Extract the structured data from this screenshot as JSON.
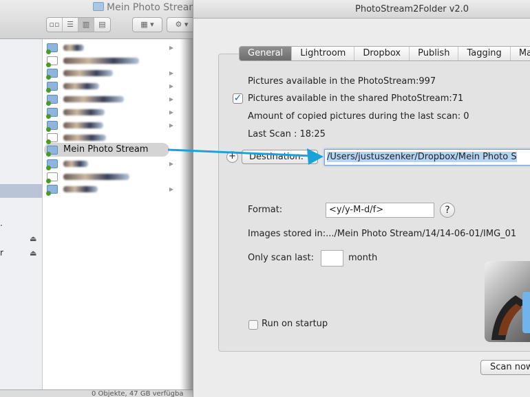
{
  "finder": {
    "title": "Mein Photo Stream",
    "view_buttons": [
      "icon-view",
      "list-view",
      "column-view",
      "coverflow-view"
    ],
    "selected_folder": "Mein Photo Stream",
    "status": "0 Objekte, 47 GB verfügba",
    "sidebar_fragments": [
      ".",
      "r"
    ]
  },
  "dialog": {
    "title": "PhotoStream2Folder v2.0",
    "tabs": [
      "General",
      "Lightroom",
      "Dropbox",
      "Publish",
      "Tagging",
      "Ma"
    ],
    "active_tab": "General",
    "pictures_available": "Pictures available in the PhotoStream:997",
    "shared_available": "Pictures available in the shared PhotoStream:71",
    "shared_checked": true,
    "copied_last_scan": "Amount of copied pictures during the last scan: 0",
    "last_scan": "Last Scan : 18:25",
    "plus_label": "+",
    "destination_label": "Destination:",
    "destination_path": "/Users/justuszenker/Dropbox/Mein Photo S",
    "format_label": "Format:",
    "format_value": "<y/y-M-d/f>",
    "help_label": "?",
    "images_stored": "Images stored in:.../Mein Photo Stream/14/14-06-01/IMG_01",
    "only_scan_label": "Only scan last:",
    "only_scan_value": "",
    "month_label": "month",
    "run_on_startup_label": "Run on startup",
    "run_on_startup_checked": false,
    "scan_now_label": "Scan now",
    "accent": "#1aa3d9"
  }
}
